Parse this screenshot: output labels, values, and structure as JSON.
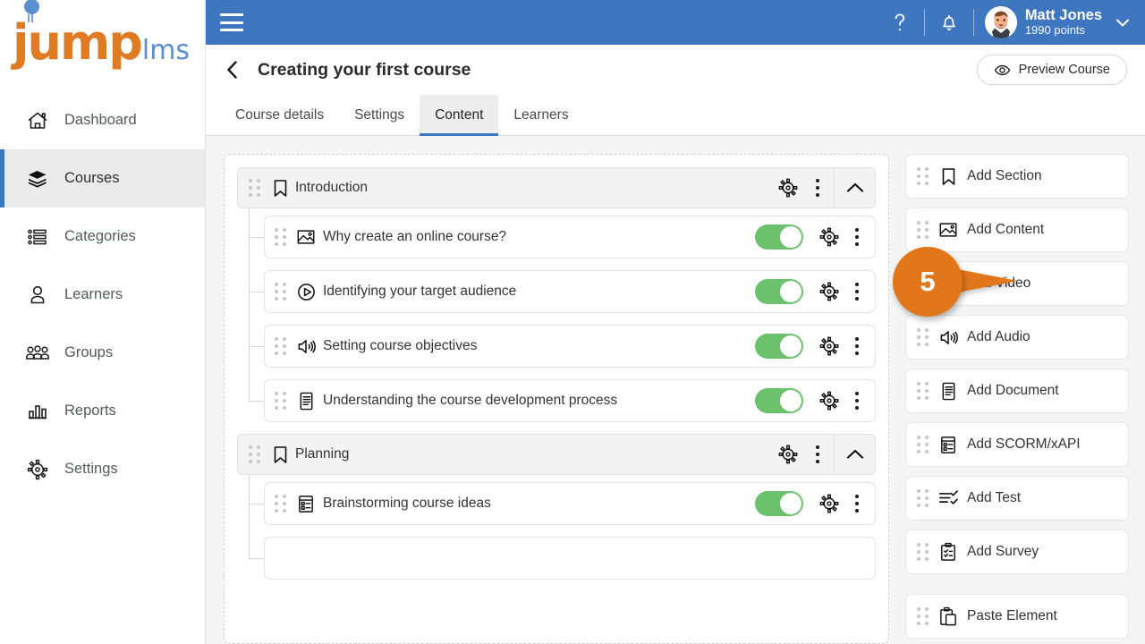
{
  "brand": {
    "logo_primary": "jump",
    "logo_secondary": "lms",
    "orange": "#e07b24",
    "blue": "#5b8fd0"
  },
  "sidebar": {
    "items": [
      {
        "label": "Dashboard",
        "icon": "home-icon",
        "active": false
      },
      {
        "label": "Courses",
        "icon": "books-icon",
        "active": true
      },
      {
        "label": "Categories",
        "icon": "list-icon",
        "active": false
      },
      {
        "label": "Learners",
        "icon": "user-icon",
        "active": false
      },
      {
        "label": "Groups",
        "icon": "users-icon",
        "active": false
      },
      {
        "label": "Reports",
        "icon": "bar-chart-icon",
        "active": false
      },
      {
        "label": "Settings",
        "icon": "settings-gear-icon",
        "active": false
      }
    ]
  },
  "topbar": {
    "menu_icon": "hamburger-icon",
    "help_icon": "question-mark-icon",
    "notifications_icon": "bell-icon",
    "user_name": "Matt Jones",
    "user_points": "1990 points",
    "chevron_icon": "chevron-down-icon",
    "background": "#3e77bf"
  },
  "page": {
    "back_icon": "back-chevron-icon",
    "title": "Creating your first course",
    "preview_label": "Preview Course",
    "preview_icon": "eye-icon"
  },
  "tabs": [
    {
      "label": "Course details",
      "active": false
    },
    {
      "label": "Settings",
      "active": false
    },
    {
      "label": "Content",
      "active": true
    },
    {
      "label": "Learners",
      "active": false
    }
  ],
  "content": {
    "sections": [
      {
        "title": "Introduction",
        "icon": "bookmark-icon",
        "collapsed": false,
        "items": [
          {
            "title": "Why create an online course?",
            "icon": "image-icon",
            "toggle": "on"
          },
          {
            "title": "Identifying your target audience",
            "icon": "play-circle-icon",
            "toggle": "on"
          },
          {
            "title": "Setting course objectives",
            "icon": "speaker-icon",
            "toggle": "on"
          },
          {
            "title": "Understanding the course development process",
            "icon": "document-icon",
            "toggle": "on"
          }
        ]
      },
      {
        "title": "Planning",
        "icon": "bookmark-icon",
        "collapsed": false,
        "items": [
          {
            "title": "Brainstorming course ideas",
            "icon": "scorm-icon",
            "toggle": "on"
          }
        ]
      }
    ],
    "toggle_on_color": "#6cc16c"
  },
  "rail": {
    "items": [
      {
        "label": "Add Section",
        "icon": "bookmark-icon"
      },
      {
        "label": "Add Content",
        "icon": "image-icon"
      },
      {
        "label": "Add Video",
        "icon": "play-circle-icon"
      },
      {
        "label": "Add Audio",
        "icon": "speaker-icon"
      },
      {
        "label": "Add Document",
        "icon": "document-icon"
      },
      {
        "label": "Add SCORM/xAPI",
        "icon": "scorm-icon"
      },
      {
        "label": "Add Test",
        "icon": "test-icon"
      },
      {
        "label": "Add Survey",
        "icon": "survey-icon"
      }
    ],
    "paste": {
      "label": "Paste Element",
      "icon": "paste-icon"
    }
  },
  "callout": {
    "number": "5",
    "color": "#e2761b"
  }
}
